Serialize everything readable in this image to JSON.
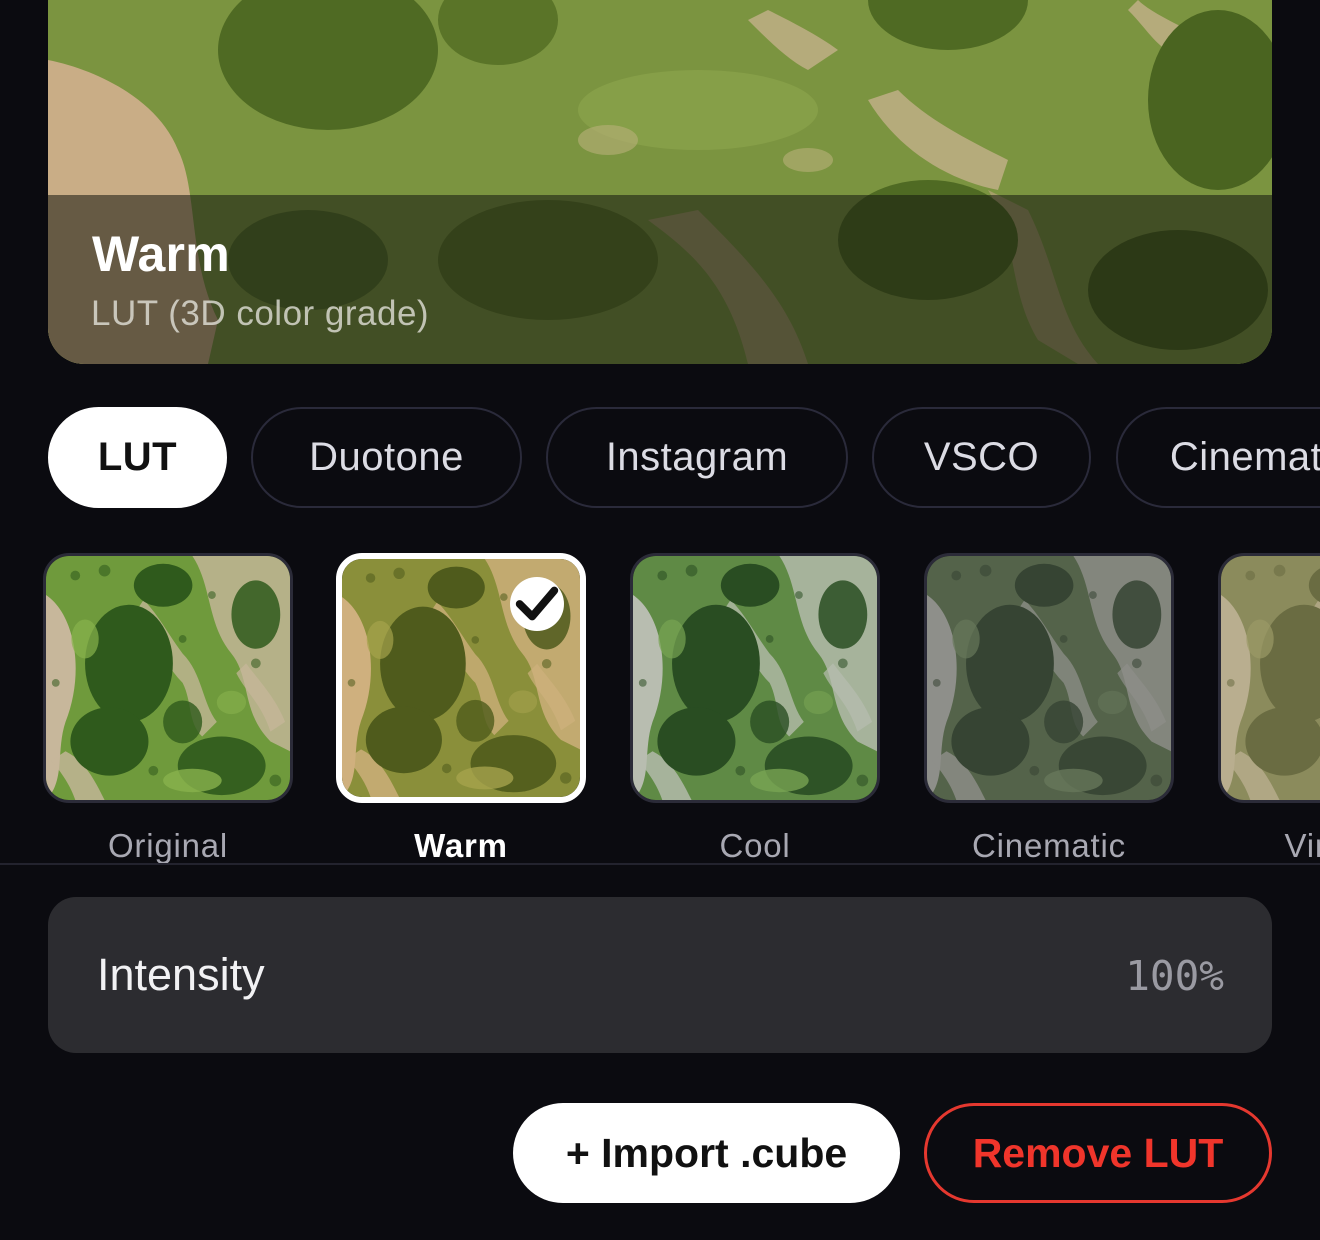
{
  "preview": {
    "title": "Warm",
    "subtitle": "LUT (3D color grade)"
  },
  "tabs": [
    {
      "label": "LUT",
      "active": true
    },
    {
      "label": "Duotone",
      "active": false
    },
    {
      "label": "Instagram",
      "active": false
    },
    {
      "label": "VSCO",
      "active": false
    },
    {
      "label": "Cinematic",
      "active": false
    }
  ],
  "presets": [
    {
      "label": "Original",
      "selected": false
    },
    {
      "label": "Warm",
      "selected": true
    },
    {
      "label": "Cool",
      "selected": false
    },
    {
      "label": "Cinematic",
      "selected": false
    },
    {
      "label": "Vintage",
      "selected": false
    }
  ],
  "intensity": {
    "label": "Intensity",
    "value": "100%"
  },
  "actions": {
    "import_label": "+ Import .cube",
    "remove_label": "Remove LUT"
  },
  "colors": {
    "background": "#0b0b10",
    "accent_destructive": "#f0352b",
    "active_tab": "#ffffff",
    "panel": "#2c2c30"
  },
  "icons": {
    "selected_check": "checkmark-icon"
  }
}
